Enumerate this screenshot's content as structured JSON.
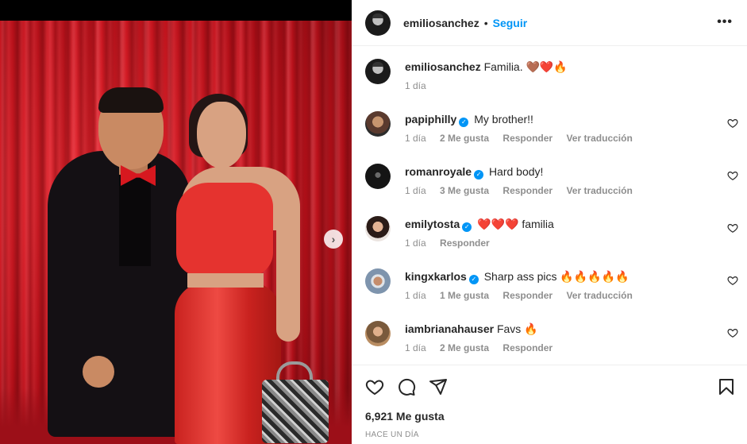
{
  "post": {
    "author": "emiliosanchez",
    "follow_label": "Seguir",
    "separator": "•",
    "caption": {
      "username": "emiliosanchez",
      "text": "Familia. 🤎❤️🔥",
      "time": "1 día"
    },
    "comments": [
      {
        "username": "papiphilly",
        "verified": true,
        "text": "My brother!!",
        "time": "1 día",
        "likes": "2 Me gusta",
        "reply": "Responder",
        "translate": "Ver traducción",
        "avatar": "papiphilly-avatar"
      },
      {
        "username": "romanroyale",
        "verified": true,
        "text": "Hard body!",
        "time": "1 día",
        "likes": "3 Me gusta",
        "reply": "Responder",
        "translate": "Ver traducción",
        "avatar": "romanroyale-avatar"
      },
      {
        "username": "emilytosta",
        "verified": true,
        "text": "❤️❤️❤️ familia",
        "time": "1 día",
        "likes": "",
        "reply": "Responder",
        "translate": "",
        "avatar": "emilytosta-avatar"
      },
      {
        "username": "kingxkarlos",
        "verified": true,
        "text": "Sharp ass pics 🔥🔥🔥🔥🔥",
        "time": "1 día",
        "likes": "1 Me gusta",
        "reply": "Responder",
        "translate": "Ver traducción",
        "avatar": "kingxkarlos-avatar"
      },
      {
        "username": "iambrianahauser",
        "verified": false,
        "text": "Favs 🔥",
        "time": "1 día",
        "likes": "2 Me gusta",
        "reply": "Responder",
        "translate": "",
        "avatar": "iambrianahauser-avatar"
      }
    ],
    "like_count": "6,921 Me gusta",
    "timestamp": "HACE UN DÍA"
  },
  "icons": {
    "more": "more-options-icon",
    "like": "heart-icon",
    "comment": "comment-icon",
    "share": "share-icon",
    "save": "bookmark-icon",
    "next": "chevron-right-icon"
  },
  "colors": {
    "accent": "#0095f6",
    "muted": "#8e8e8e",
    "text": "#262626"
  }
}
